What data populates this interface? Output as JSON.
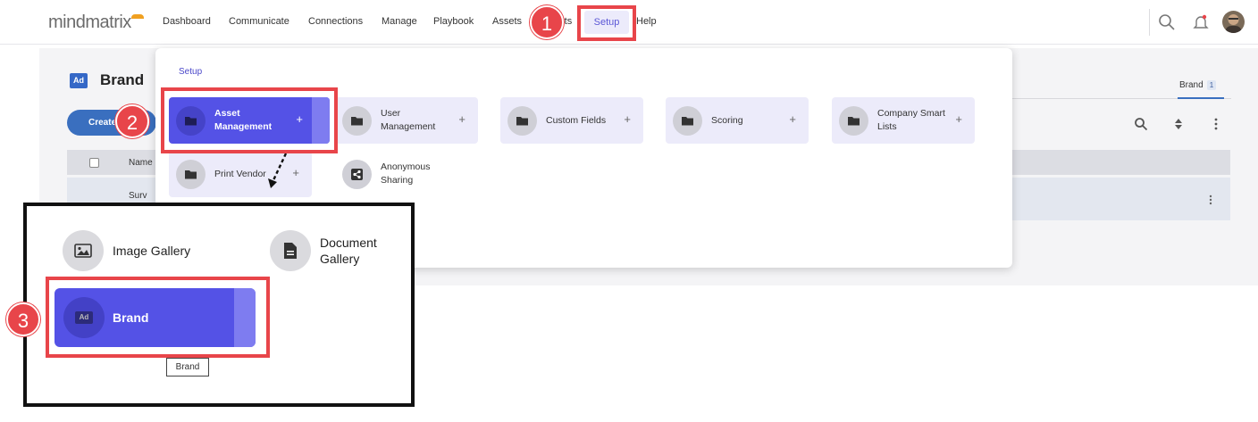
{
  "app": {
    "logo_text": "mindmatrix"
  },
  "nav": {
    "dashboard": "Dashboard",
    "communicate": "Communicate",
    "connections": "Connections",
    "manage": "Manage",
    "playbook": "Playbook",
    "assets": "Assets",
    "reports_partial": "rts",
    "setup": "Setup",
    "help": "Help"
  },
  "page": {
    "badge": "Ad",
    "title": "Brand",
    "create_button": "Create",
    "table_header_name": "Name",
    "row_name_partial": "Surv",
    "tab_brand": "Brand",
    "tab_brand_count": "1"
  },
  "dropdown": {
    "title": "Setup",
    "tiles": [
      {
        "label": "Asset Management",
        "plus": "+"
      },
      {
        "label": "User Management",
        "plus": "+"
      },
      {
        "label": "Custom Fields",
        "plus": "+"
      },
      {
        "label": "Scoring",
        "plus": "+"
      },
      {
        "label": "Company Smart Lists",
        "plus": "+"
      },
      {
        "label": "Print Vendor",
        "plus": "+"
      },
      {
        "label": "Anonymous Sharing"
      }
    ]
  },
  "inset": {
    "image_gallery": "Image Gallery",
    "document_gallery": "Document Gallery",
    "brand": "Brand",
    "brand_badge": "Ad",
    "tooltip": "Brand"
  },
  "callouts": {
    "one": "1",
    "two": "2",
    "three": "3"
  },
  "colors": {
    "accent": "#5452e6",
    "highlight": "#e8454a",
    "primary_blue": "#3a6fbf"
  }
}
